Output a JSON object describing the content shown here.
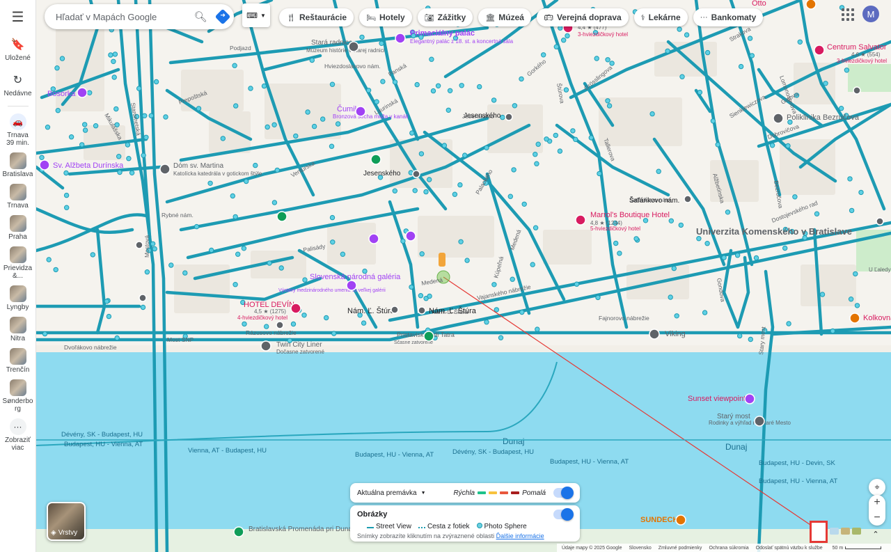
{
  "search": {
    "placeholder": "Hľadať v Mapách Google"
  },
  "rail": {
    "saved": "Uložené",
    "recent": "Nedávne",
    "trip": "Trnava\n39 min.",
    "items": [
      "Bratislava",
      "Trnava",
      "Praha",
      "Prievidza &...",
      "Lyngby",
      "Nitra",
      "Trenčín",
      "Sønderbo rg"
    ],
    "more": "Zobraziť viac"
  },
  "chips": [
    {
      "icon": "fork-knife-icon",
      "label": "Reštaurácie"
    },
    {
      "icon": "bed-icon",
      "label": "Hotely"
    },
    {
      "icon": "camera-icon",
      "label": "Zážitky"
    },
    {
      "icon": "museum-icon",
      "label": "Múzeá"
    },
    {
      "icon": "bus-icon",
      "label": "Verejná doprava"
    },
    {
      "icon": "pharmacy-icon",
      "label": "Lekárne"
    },
    {
      "icon": "more-icon",
      "label": "Bankomaty"
    }
  ],
  "account": {
    "initial": "M",
    "color": "#5c6bc0"
  },
  "layers_button": {
    "label": "Vrstvy"
  },
  "panel": {
    "traffic_select": "Aktuálna premávka",
    "fast": "Rýchla",
    "slow": "Pomalá",
    "traffic_colors": [
      "#1ec28b",
      "#f7c23e",
      "#e8573d",
      "#a81d1d"
    ],
    "photos_title": "Obrázky",
    "street_view": "Street View",
    "photo_path": "Cesta z fotiek",
    "photo_sphere": "Photo Sphere",
    "note": "Snímky zobrazíte kliknutím na zvýraznené oblasti",
    "more_link": "Ďalšie informácie"
  },
  "footer": {
    "data": "Údaje mapy © 2025 Google",
    "country": "Slovensko",
    "terms": "Zmluvné podmienky",
    "privacy": "Ochrana súkromia",
    "feedback": "Odoslať spätnú väzbu k službe",
    "scale": "50 m"
  },
  "labels": {
    "dunaj": "Dunaj",
    "streets": [
      "Starometská",
      "Mostová",
      "Most SNP",
      "Rázusovo nábrežie",
      "Vajanského nábrežie",
      "Fajnorovo nábrežie",
      "Medená",
      "Kúpeľná",
      "Palackého",
      "Jesenského",
      "Štúrova",
      "Grösslingova",
      "Gorkého",
      "Dobrovičova",
      "Bezručova",
      "Gajova",
      "Lomonosovova",
      "Medená",
      "Šafárikovo nám.",
      "Dostojevského rad",
      "Palisády",
      "Panská",
      "Sienkiewiczova",
      "Alžbetínska",
      "Gondova",
      "Podjazd",
      "Prepoštská",
      "Mikulášska",
      "Hviezdoslavovo nám.",
      "Rybné nám.",
      "Nám. Ľ. Štúra",
      "Ventúrska",
      "Laurinská",
      "Strakova",
      "Tallerova",
      "Dvořákovo nábrežie",
      "Stary most"
    ],
    "pois": [
      "Primaciálny palác",
      "Elegantný palác z 18. st. a koncertná sála",
      "Stará radnica",
      "Múzeum histórie v starej radnici",
      "Čumil",
      "Bronzová socha muža v kanáli",
      "Bosorka",
      "Sv. Alžbeta Durínska",
      "Dóm sv. Martina",
      "Katolícka katedrála v gotickom štýle",
      "Slovenská národná galéria",
      "Výstavy medzinárodného umenia vo veľkej galérii",
      "HOTEL DEVÍN",
      "4,5 ★ (1275)",
      "4-hviezdičkový hotel",
      "Marrol's Boutique Hotel",
      "4,8 ★ (1244)",
      "5-hviezdičkový hotel",
      "Centrum Salvator",
      "4,6 ★ (554)",
      "3-hviezdičkový hotel",
      "4,4 ★ (477)",
      "3-hviezdičkový hotel",
      "Poliklinika Bezručova",
      "Univerzita Komenského v Bratislave",
      "Šafárikovo nám.",
      "Jesenského",
      "Jesenského",
      "Nám. Ľ. Štúra",
      "Nám. Ľ. Štúra",
      "Viking",
      "Twin City Liner",
      "Dočasne zatvorené",
      "Sunset viewpoint",
      "Starý most",
      "Rodinky a výhľad na Staré Mesto",
      "SUNDECK",
      "Bratislavská Promenáda pri Dunaji",
      "Kolkovna",
      "Otto",
      "Pristavisko lodí Tatra",
      "Sčasne zatvorené",
      "U Ľaledy"
    ],
    "ferries": [
      "Dévény, SK - Budapest, HU",
      "Budapest, HU - Vienna, AT",
      "Vienna, AT - Budapest, HU",
      "Budapest, HU - Vienna, AT",
      "Dévény, SK - Budapest, HU",
      "Budapest, HU - Vienna, AT",
      "Budapest, HU - Devin, SK",
      "Budapest, HU - Vienna, AT"
    ]
  }
}
